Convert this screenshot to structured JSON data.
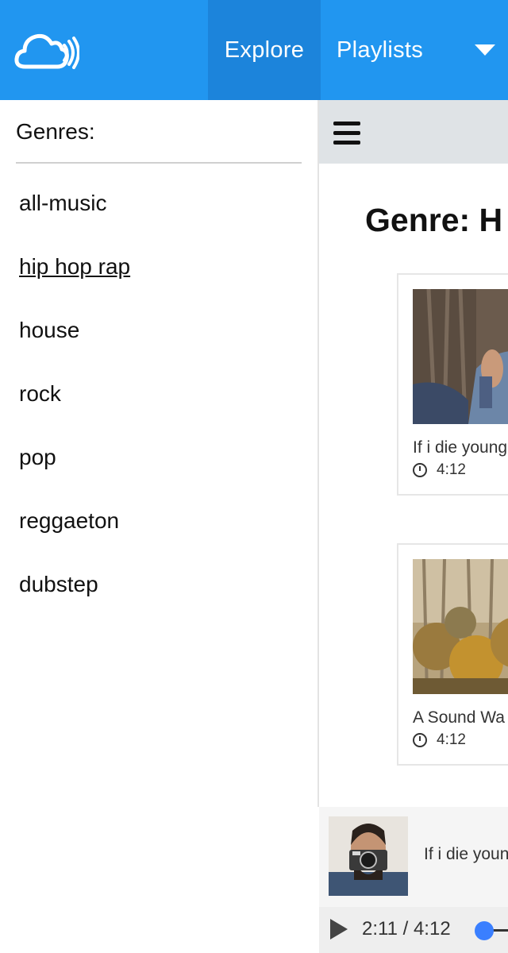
{
  "header": {
    "logo_name": "cloud-signal-logo",
    "nav": [
      {
        "label": "Explore",
        "active": true
      },
      {
        "label": "Playlists",
        "active": false
      }
    ],
    "dropdown_icon": "caret-down-icon",
    "background": "#2196f0",
    "active_background": "#1c84db"
  },
  "sidebar": {
    "title": "Genres:",
    "genres": [
      {
        "label": "all-music"
      },
      {
        "label": "hip hop rap",
        "active": true
      },
      {
        "label": "house"
      },
      {
        "label": "rock"
      },
      {
        "label": "pop"
      },
      {
        "label": "reggaeton"
      },
      {
        "label": "dubstep"
      }
    ]
  },
  "main": {
    "menu_icon": "hamburger-menu-icon",
    "heading": "Genre: H",
    "tracks": [
      {
        "title": "If i die young",
        "duration": "4:12"
      },
      {
        "title": "A Sound Wa",
        "duration": "4:12"
      }
    ]
  },
  "player": {
    "title": "If i die youn",
    "current_time": "2:11",
    "separator": "/",
    "total_time": "4:12",
    "accent": "#3a7fff"
  }
}
